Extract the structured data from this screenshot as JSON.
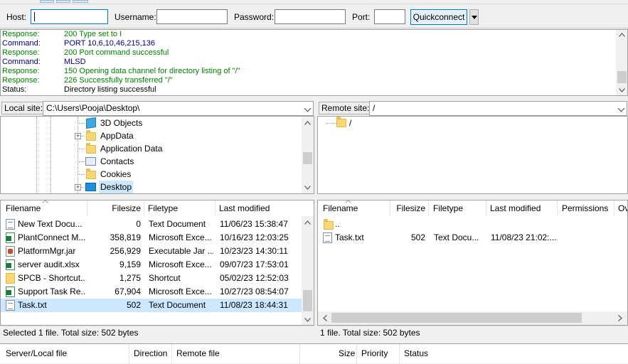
{
  "quickconnect": {
    "host_label": "Host:",
    "host_value": "",
    "username_label": "Username:",
    "username_value": "",
    "password_label": "Password:",
    "password_value": "",
    "port_label": "Port:",
    "port_value": "",
    "button_label": "Quickconnect",
    "dropdown_icon": "chevron-down-icon"
  },
  "message_log": [
    {
      "kind": "Response:",
      "text": "200 Type set to I",
      "color": "#008000"
    },
    {
      "kind": "Command:",
      "text": "PORT 10,6,10,46,215,136",
      "color": "#000080"
    },
    {
      "kind": "Response:",
      "text": "200 Port command successful",
      "color": "#008000"
    },
    {
      "kind": "Command:",
      "text": "MLSD",
      "color": "#000080"
    },
    {
      "kind": "Response:",
      "text": "150 Opening data channel for directory listing of \"/\"",
      "color": "#008000"
    },
    {
      "kind": "Response:",
      "text": "226 Successfully transferred \"/\"",
      "color": "#008000"
    },
    {
      "kind": "Status:",
      "text": "Directory listing successful",
      "color": "#000000"
    }
  ],
  "local_site": {
    "label": "Local site:",
    "path": "C:\\Users\\Pooja\\Desktop\\",
    "tree": [
      {
        "name": "3D Objects",
        "icon": "3d-objects-icon",
        "expander": false,
        "selected": false
      },
      {
        "name": "AppData",
        "icon": "folder-icon",
        "expander": true,
        "selected": false
      },
      {
        "name": "Application Data",
        "icon": "folder-icon",
        "expander": false,
        "selected": false
      },
      {
        "name": "Contacts",
        "icon": "contacts-icon",
        "expander": false,
        "selected": false
      },
      {
        "name": "Cookies",
        "icon": "folder-icon",
        "expander": false,
        "selected": false
      },
      {
        "name": "Desktop",
        "icon": "desktop-icon",
        "expander": true,
        "selected": true
      }
    ],
    "columns": {
      "filename": "Filename",
      "filesize": "Filesize",
      "filetype": "Filetype",
      "modified": "Last modified"
    },
    "files": [
      {
        "name": "New Text Docu...",
        "size": "0",
        "type": "Text Document",
        "modified": "11/06/23 15:38:47",
        "icon": "text-file-icon",
        "selected": false
      },
      {
        "name": "PlantConnect M...",
        "size": "358,819",
        "type": "Microsoft Exce...",
        "modified": "10/16/23 12:03:25",
        "icon": "excel-file-icon",
        "selected": false
      },
      {
        "name": "PlatformMgr.jar",
        "size": "256,929",
        "type": "Executable Jar ...",
        "modified": "10/23/23 14:30:11",
        "icon": "jar-file-icon",
        "selected": false
      },
      {
        "name": "server audit.xlsx",
        "size": "9,159",
        "type": "Microsoft Exce...",
        "modified": "09/07/23 17:53:01",
        "icon": "excel-file-icon",
        "selected": false
      },
      {
        "name": "SPCB - Shortcut....",
        "size": "1,275",
        "type": "Shortcut",
        "modified": "05/02/23 12:52:03",
        "icon": "shortcut-icon",
        "selected": false
      },
      {
        "name": "Support Task Re...",
        "size": "67,904",
        "type": "Microsoft Exce...",
        "modified": "10/27/23 08:54:07",
        "icon": "excel-file-icon",
        "selected": false
      },
      {
        "name": "Task.txt",
        "size": "502",
        "type": "Text Document",
        "modified": "11/08/23 18:44:31",
        "icon": "text-file-icon",
        "selected": true
      }
    ],
    "status": "Selected 1 file. Total size: 502 bytes"
  },
  "remote_site": {
    "label": "Remote site:",
    "path": "/",
    "tree": [
      {
        "name": "/",
        "icon": "folder-icon"
      }
    ],
    "columns": {
      "filename": "Filename",
      "filesize": "Filesize",
      "filetype": "Filetype",
      "modified": "Last modified",
      "permissions": "Permissions",
      "owner": "Ov"
    },
    "files": [
      {
        "name": "..",
        "size": "",
        "type": "",
        "modified": "",
        "icon": "folder-icon"
      },
      {
        "name": "Task.txt",
        "size": "502",
        "type": "Text Docu...",
        "modified": "11/08/23 21:02:...",
        "icon": "text-file-icon"
      }
    ],
    "status": "1 file. Total size: 502 bytes"
  },
  "queue": {
    "columns": {
      "server_local": "Server/Local file",
      "direction": "Direction",
      "remote": "Remote file",
      "size": "Size",
      "priority": "Priority",
      "status": "Status"
    }
  },
  "colors": {
    "selection": "#cce8ff",
    "accent": "#0078d7",
    "response": "#008000",
    "command": "#000080"
  }
}
